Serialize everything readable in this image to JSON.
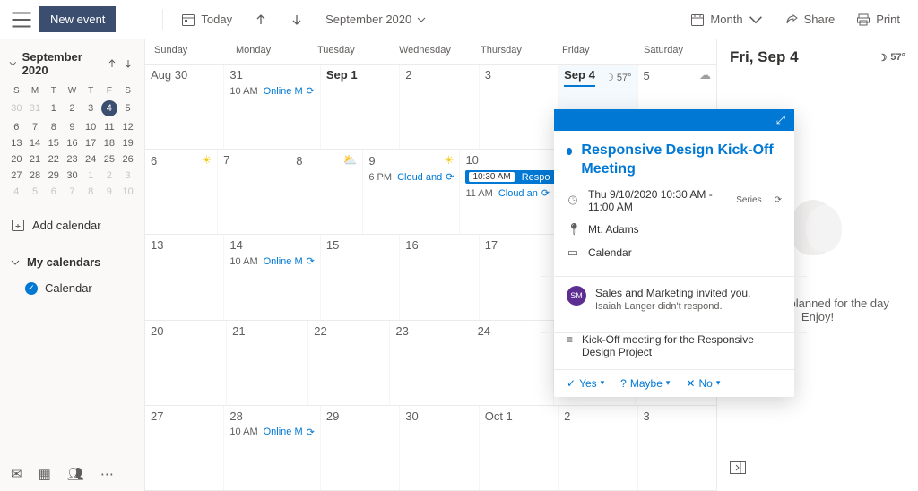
{
  "toolbar": {
    "new_event": "New event",
    "today": "Today",
    "month_label": "September 2020",
    "view": "Month",
    "share": "Share",
    "print": "Print"
  },
  "mini": {
    "header": "September 2020",
    "dow": [
      "S",
      "M",
      "T",
      "W",
      "T",
      "F",
      "S"
    ],
    "rows": [
      [
        {
          "n": "30",
          "o": true
        },
        {
          "n": "31",
          "o": true
        },
        {
          "n": "1"
        },
        {
          "n": "2"
        },
        {
          "n": "3"
        },
        {
          "n": "4",
          "sel": true
        },
        {
          "n": "5"
        }
      ],
      [
        {
          "n": "6"
        },
        {
          "n": "7"
        },
        {
          "n": "8"
        },
        {
          "n": "9"
        },
        {
          "n": "10"
        },
        {
          "n": "11"
        },
        {
          "n": "12"
        }
      ],
      [
        {
          "n": "13"
        },
        {
          "n": "14"
        },
        {
          "n": "15"
        },
        {
          "n": "16"
        },
        {
          "n": "17"
        },
        {
          "n": "18"
        },
        {
          "n": "19"
        }
      ],
      [
        {
          "n": "20"
        },
        {
          "n": "21"
        },
        {
          "n": "22"
        },
        {
          "n": "23"
        },
        {
          "n": "24"
        },
        {
          "n": "25"
        },
        {
          "n": "26"
        }
      ],
      [
        {
          "n": "27"
        },
        {
          "n": "28"
        },
        {
          "n": "29"
        },
        {
          "n": "30"
        },
        {
          "n": "1",
          "o": true
        },
        {
          "n": "2",
          "o": true
        },
        {
          "n": "3",
          "o": true
        }
      ],
      [
        {
          "n": "4",
          "o": true
        },
        {
          "n": "5",
          "o": true
        },
        {
          "n": "6",
          "o": true
        },
        {
          "n": "7",
          "o": true
        },
        {
          "n": "8",
          "o": true
        },
        {
          "n": "9",
          "o": true
        },
        {
          "n": "10",
          "o": true
        }
      ]
    ]
  },
  "sidebar": {
    "add_calendar": "Add calendar",
    "my_calendars": "My calendars",
    "calendar_item": "Calendar"
  },
  "grid": {
    "dow": [
      "Sunday",
      "Monday",
      "Tuesday",
      "Wednesday",
      "Thursday",
      "Friday",
      "Saturday"
    ],
    "cells": {
      "aug30": "Aug 30",
      "d31": "31",
      "sep1": "Sep 1",
      "d2": "2",
      "d3": "3",
      "sep4": "Sep 4",
      "d5": "5",
      "d6": "6",
      "d7": "7",
      "d8": "8",
      "d9": "9",
      "d10": "10",
      "d13": "13",
      "d14": "14",
      "d15": "15",
      "d16": "16",
      "d17": "17",
      "d20": "20",
      "d21": "21",
      "d22": "22",
      "d23": "23",
      "d24": "24",
      "d27": "27",
      "d28": "28",
      "d29": "29",
      "d30": "30",
      "oct1": "Oct 1",
      "o2": "2",
      "o3": "3"
    },
    "temp4": "57°",
    "events": {
      "mon31": {
        "time": "10 AM",
        "title": "Online M"
      },
      "wed9": {
        "time": "6 PM",
        "title": "Cloud and"
      },
      "thu10a": {
        "time": "10:30 AM",
        "title": "Respo"
      },
      "thu10b": {
        "time": "11 AM",
        "title": "Cloud an"
      },
      "mon14": {
        "time": "10 AM",
        "title": "Online M"
      },
      "mon28": {
        "time": "10 AM",
        "title": "Online M"
      }
    }
  },
  "right": {
    "heading": "Fri, Sep 4",
    "temp": "57°",
    "nothing": "Nothing planned for the day",
    "enjoy": "Enjoy!"
  },
  "popover": {
    "title": "Responsive Design Kick-Off Meeting",
    "datetime": "Thu 9/10/2020 10:30 AM - 11:00 AM",
    "series": "Series",
    "location": "Mt. Adams",
    "calendar": "Calendar",
    "inviter_initials": "SM",
    "inviter_line": "Sales and Marketing invited you.",
    "inviter_sub": "Isaiah Langer didn't respond.",
    "desc": "Kick-Off meeting for the Responsive Design Project",
    "yes": "Yes",
    "maybe": "Maybe",
    "no": "No"
  }
}
